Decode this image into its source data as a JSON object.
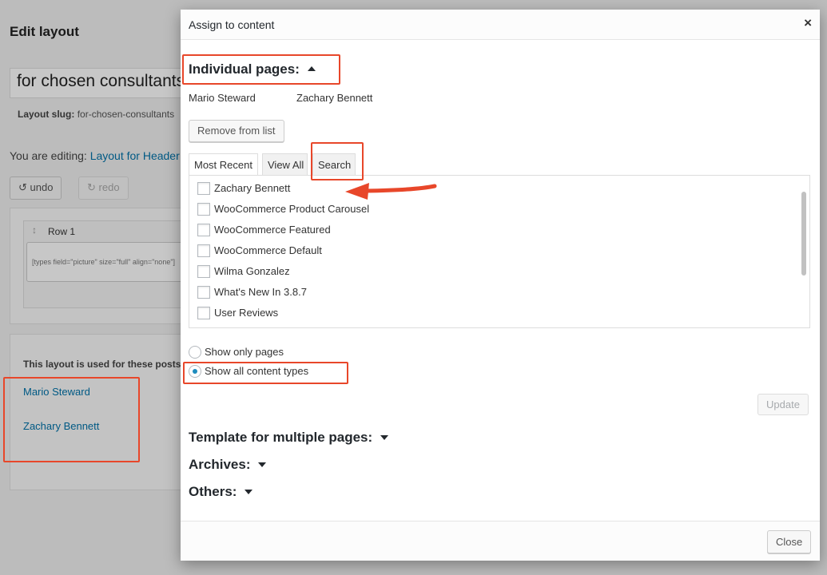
{
  "background": {
    "page_title": "Edit layout",
    "layout_name_value": "for chosen consultants",
    "slug_label": "Layout slug:",
    "slug_value": "for-chosen-consultants",
    "editing_prefix": "You are editing:",
    "editing_link": "Layout for Header",
    "undo_label": "undo",
    "redo_label": "redo",
    "row_label": "Row 1",
    "cell_content": "[types field=\"picture\" size=\"full\" align=\"none\"]",
    "used_title": "This layout is used for these posts:",
    "used_posts": [
      "Mario Steward",
      "Zachary Bennett"
    ]
  },
  "modal": {
    "title": "Assign to content",
    "close_x": "×",
    "individual_heading": "Individual pages:",
    "chosen_items": [
      "Mario Steward",
      "Zachary Bennett"
    ],
    "remove_button": "Remove from list",
    "tabs": [
      {
        "label": "Most Recent",
        "active": true
      },
      {
        "label": "View All",
        "active": false
      },
      {
        "label": "Search",
        "active": false
      }
    ],
    "list_items": [
      "Zachary Bennett",
      "WooCommerce Product Carousel",
      "WooCommerce Featured",
      "WooCommerce Default",
      "Wilma Gonzalez",
      "What's New In 3.8.7",
      "User Reviews"
    ],
    "radio_options": [
      {
        "label": "Show only pages",
        "checked": false
      },
      {
        "label": "Show all content types",
        "checked": true
      }
    ],
    "update_button": "Update",
    "collapsed_sections": [
      "Template for multiple pages:",
      "Archives:",
      "Others:"
    ],
    "close_button": "Close"
  },
  "colors": {
    "link": "#0073aa",
    "annotation": "#e8472a",
    "radio_checked": "#1e8cbe"
  }
}
